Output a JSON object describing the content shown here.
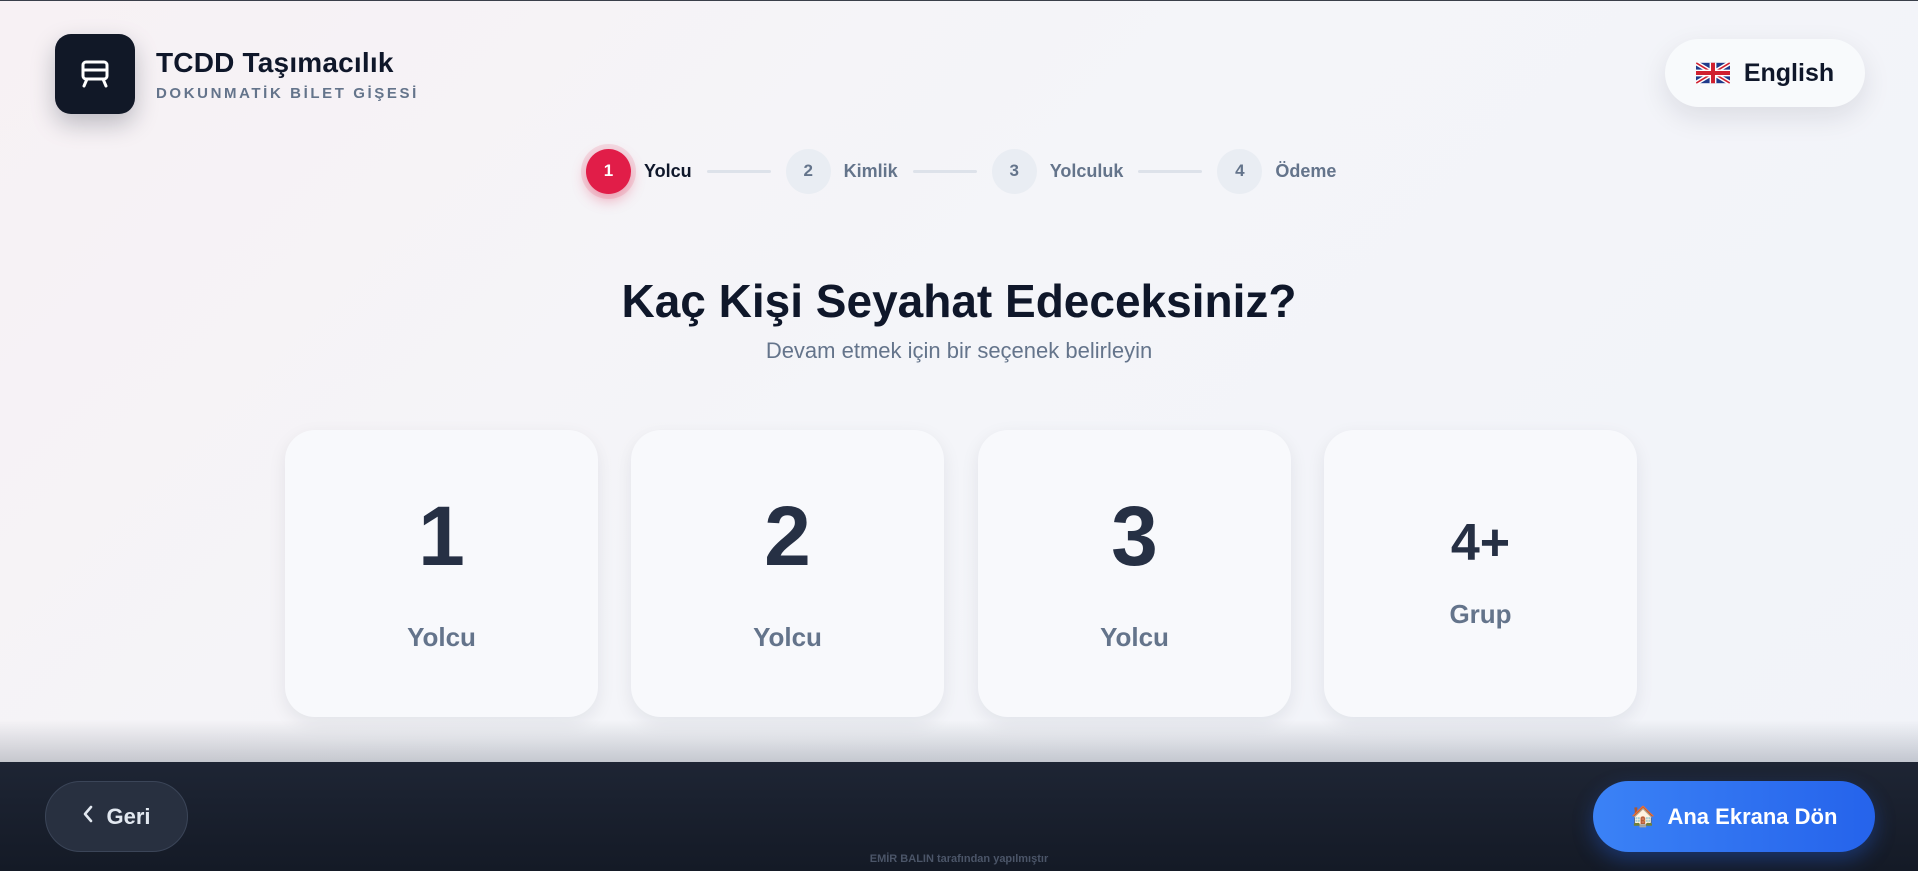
{
  "header": {
    "title": "TCDD Taşımacılık",
    "subtitle": "DOKUNMATİK BİLET GİŞESİ",
    "logo_icon": "train-icon"
  },
  "language": {
    "label": "English",
    "flag_icon": "uk-flag-icon"
  },
  "stepper": {
    "steps": [
      {
        "number": "1",
        "label": "Yolcu",
        "active": true
      },
      {
        "number": "2",
        "label": "Kimlik",
        "active": false
      },
      {
        "number": "3",
        "label": "Yolculuk",
        "active": false
      },
      {
        "number": "4",
        "label": "Ödeme",
        "active": false
      }
    ]
  },
  "main": {
    "title": "Kaç Kişi Seyahat Edeceksiniz?",
    "subtitle": "Devam etmek için bir seçenek belirleyin",
    "options": [
      {
        "value": "1",
        "label": "Yolcu"
      },
      {
        "value": "2",
        "label": "Yolcu"
      },
      {
        "value": "3",
        "label": "Yolcu"
      },
      {
        "value": "4+",
        "label": "Grup"
      }
    ]
  },
  "footer": {
    "back_label": "Geri",
    "back_icon": "chevron-left-icon",
    "home_label": "Ana Ekrana Dön",
    "home_icon": "house-icon",
    "credit": "EMİR BALIN tarafından yapılmıştır"
  },
  "colors": {
    "accent": "#e11d48",
    "primary_button": "#2563eb",
    "dark": "#111827"
  }
}
